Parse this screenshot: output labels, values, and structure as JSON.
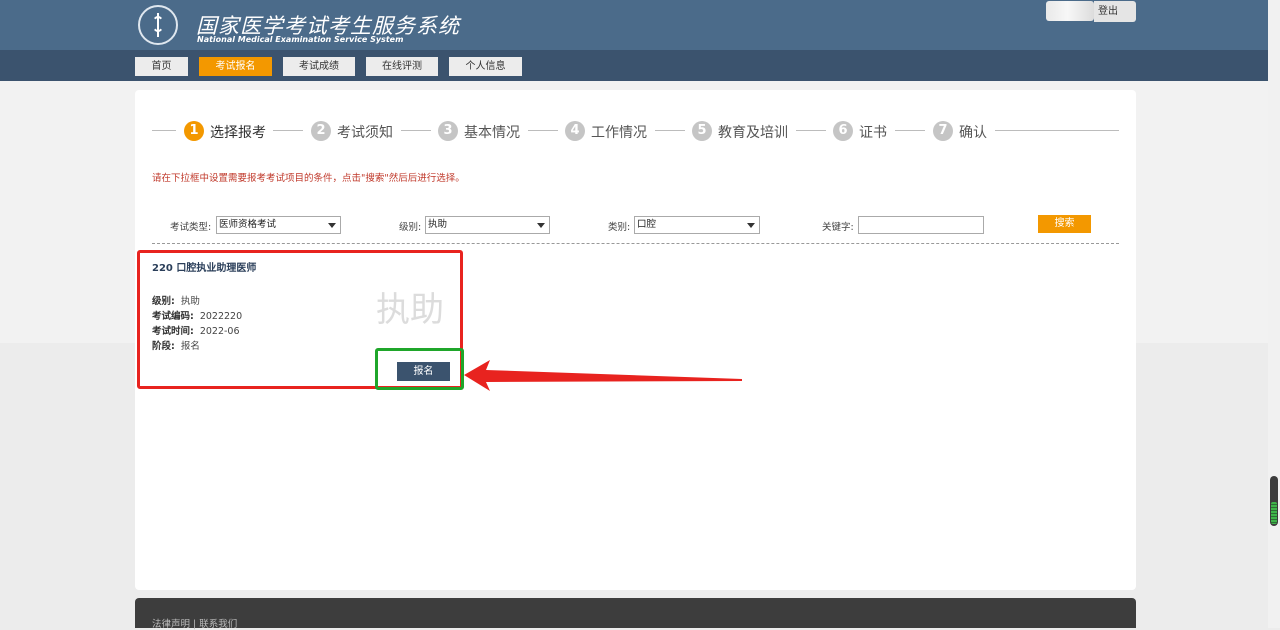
{
  "header": {
    "title_cn": "国家医学考试考生服务系统",
    "title_en": "National Medical Examination Service System",
    "logout_label": "登出"
  },
  "nav": {
    "items": [
      {
        "label": "首页",
        "active": false
      },
      {
        "label": "考试报名",
        "active": true
      },
      {
        "label": "考试成绩",
        "active": false
      },
      {
        "label": "在线评测",
        "active": false
      },
      {
        "label": "个人信息",
        "active": false
      }
    ]
  },
  "steps": [
    {
      "num": "1",
      "label": "选择报考",
      "active": true
    },
    {
      "num": "2",
      "label": "考试须知",
      "active": false
    },
    {
      "num": "3",
      "label": "基本情况",
      "active": false
    },
    {
      "num": "4",
      "label": "工作情况",
      "active": false
    },
    {
      "num": "5",
      "label": "教育及培训",
      "active": false
    },
    {
      "num": "6",
      "label": "证书",
      "active": false
    },
    {
      "num": "7",
      "label": "确认",
      "active": false
    }
  ],
  "hint": "请在下拉框中设置需要报考考试项目的条件，点击\"搜索\"然后后进行选择。",
  "filters": {
    "exam_type": {
      "label": "考试类型:",
      "value": "医师资格考试"
    },
    "level": {
      "label": "级别:",
      "value": "执助"
    },
    "category": {
      "label": "类别:",
      "value": "口腔"
    },
    "keyword": {
      "label": "关键字:",
      "value": ""
    },
    "search_label": "搜索"
  },
  "result": {
    "title": "220 口腔执业助理医师",
    "watermark": "执助",
    "rows": [
      {
        "key": "级别:",
        "value": "执助"
      },
      {
        "key": "考试编码:",
        "value": "2022220"
      },
      {
        "key": "考试时间:",
        "value": "2022-06"
      },
      {
        "key": "阶段:",
        "value": "报名"
      }
    ],
    "signup_label": "报名"
  },
  "footer": {
    "links": [
      "法律声明",
      "联系我们"
    ],
    "separator": "|"
  },
  "colors": {
    "header_bg": "#4b6b8a",
    "nav_bg": "#3b536e",
    "accent": "#f39800",
    "highlight_red": "#e8231f",
    "highlight_green": "#1fa62a"
  }
}
